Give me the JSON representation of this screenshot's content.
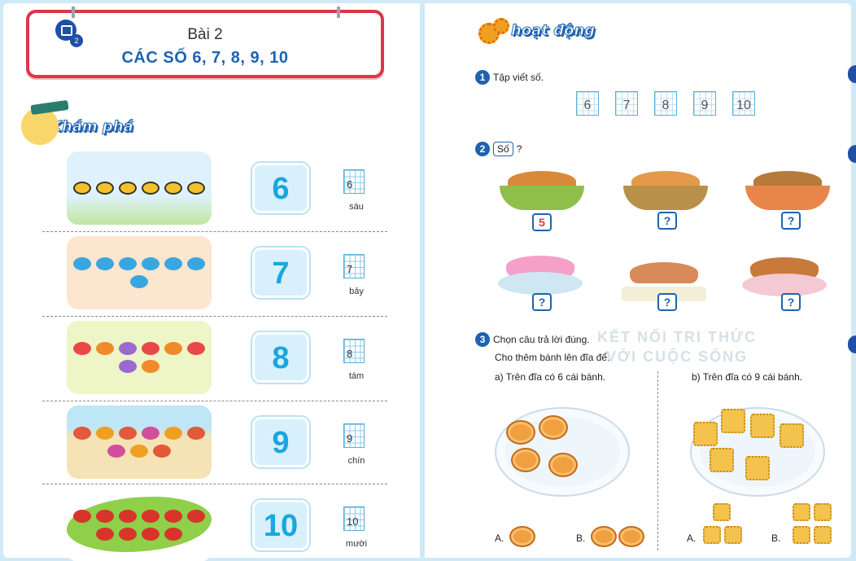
{
  "left_page": {
    "lesson_number": "2",
    "title": "Bài 2",
    "subtitle": "CÁC SỐ 6, 7, 8, 9, 10",
    "section_label": "Khám phá",
    "rows": [
      {
        "number": "6",
        "digit": "6",
        "word": "sáu",
        "picture": "bees-icon"
      },
      {
        "number": "7",
        "digit": "7",
        "word": "bảy",
        "picture": "birds-icon"
      },
      {
        "number": "8",
        "digit": "8",
        "word": "tám",
        "picture": "flowers-icon"
      },
      {
        "number": "9",
        "digit": "9",
        "word": "chín",
        "picture": "starfish-icon"
      },
      {
        "number": "10",
        "digit": "10",
        "word": "mười",
        "picture": "ladybugs-icon"
      }
    ]
  },
  "right_page": {
    "section_label": "hoạt động",
    "task1": {
      "num": "1",
      "label": "Tập viết số.",
      "digits": [
        "6",
        "7",
        "8",
        "9",
        "10"
      ]
    },
    "task2": {
      "num": "2",
      "label_box": "Số",
      "label_q": "?",
      "items": [
        {
          "name": "bread-basket-icon",
          "answer": "5"
        },
        {
          "name": "buns-basket-icon",
          "answer": "?"
        },
        {
          "name": "croissant-basket-icon",
          "answer": "?"
        },
        {
          "name": "cupcakes-plate-icon",
          "answer": "?"
        },
        {
          "name": "muffins-tray-icon",
          "answer": "?"
        },
        {
          "name": "donuts-plate-icon",
          "answer": "?"
        }
      ]
    },
    "task3": {
      "num": "3",
      "label": "Chọn câu trả lời đúng.",
      "instruction": "Cho thêm bánh lên đĩa để:",
      "a": "a)  Trên đĩa có 6 cái bánh.",
      "b": "b) Trên đĩa có 9 cái bánh.",
      "option_A": "A.",
      "option_B": "B."
    }
  },
  "watermark": {
    "line1": "KẾT NỐI TRI THỨC",
    "line2": "VỚI CUỘC SỐNG"
  }
}
